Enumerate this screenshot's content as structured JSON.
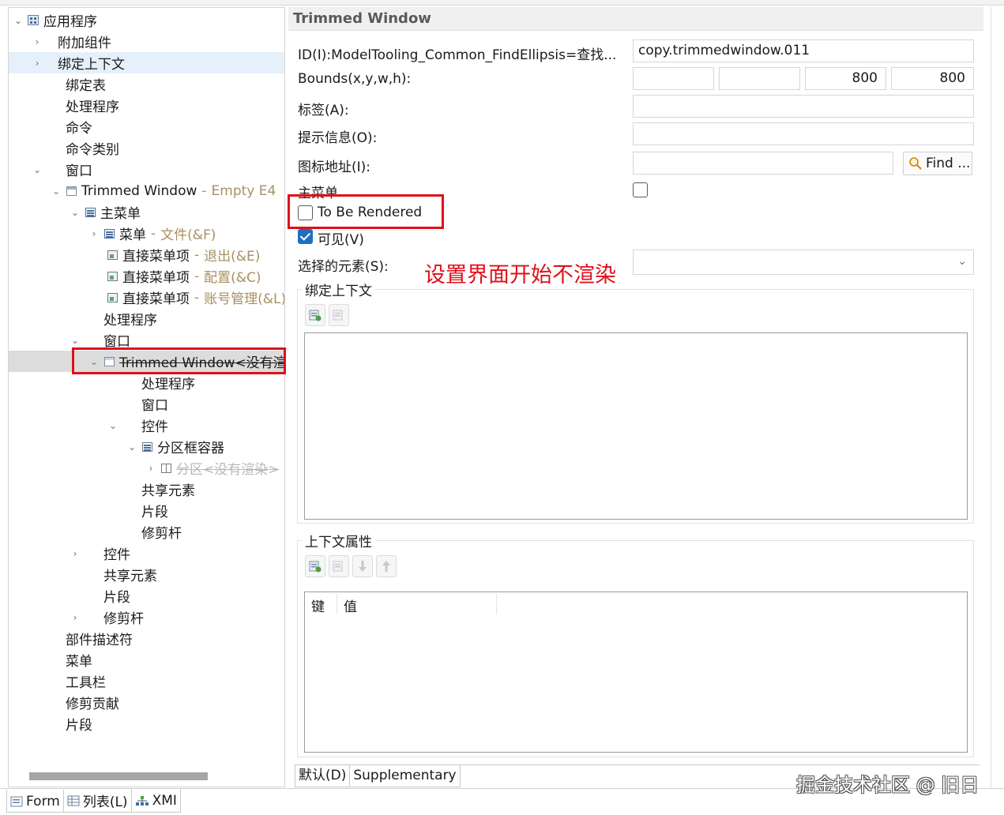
{
  "tree": {
    "rows": [
      {
        "label": "应用程序",
        "suffix": ""
      },
      {
        "label": "附加组件",
        "suffix": ""
      },
      {
        "label": "绑定上下文",
        "suffix": ""
      },
      {
        "label": "绑定表",
        "suffix": ""
      },
      {
        "label": "处理程序",
        "suffix": ""
      },
      {
        "label": "命令",
        "suffix": ""
      },
      {
        "label": "命令类别",
        "suffix": ""
      },
      {
        "label": "窗口",
        "suffix": ""
      },
      {
        "label": "Trimmed Window",
        "suffix": "Empty E4"
      },
      {
        "label": "主菜单",
        "suffix": ""
      },
      {
        "label": "菜单",
        "suffix": "文件(&F)"
      },
      {
        "label": "直接菜单项",
        "suffix": "退出(&E)"
      },
      {
        "label": "直接菜单项",
        "suffix": "配置(&C)"
      },
      {
        "label": "直接菜单项",
        "suffix": "账号管理(&L)"
      },
      {
        "label": "处理程序",
        "suffix": ""
      },
      {
        "label": "窗口",
        "suffix": ""
      },
      {
        "label": "Trimmed Window<没有渲染>",
        "suffix": ""
      },
      {
        "label": "处理程序",
        "suffix": ""
      },
      {
        "label": "窗口",
        "suffix": ""
      },
      {
        "label": "控件",
        "suffix": ""
      },
      {
        "label": "分区框容器",
        "suffix": ""
      },
      {
        "label": "分区<没有渲染>",
        "suffix": ""
      },
      {
        "label": "共享元素",
        "suffix": ""
      },
      {
        "label": "片段",
        "suffix": ""
      },
      {
        "label": "修剪杆",
        "suffix": ""
      },
      {
        "label": "控件",
        "suffix": ""
      },
      {
        "label": "共享元素",
        "suffix": ""
      },
      {
        "label": "片段",
        "suffix": ""
      },
      {
        "label": "修剪杆",
        "suffix": ""
      },
      {
        "label": "部件描述符",
        "suffix": ""
      },
      {
        "label": "菜单",
        "suffix": ""
      },
      {
        "label": "工具栏",
        "suffix": ""
      },
      {
        "label": "修剪贡献",
        "suffix": ""
      },
      {
        "label": "片段",
        "suffix": ""
      }
    ]
  },
  "props": {
    "title": "Trimmed Window",
    "id_label": "ID(I):ModelTooling_Common_FindEllipsis=查找...",
    "id_value": "copy.trimmedwindow.011",
    "bounds_label": "Bounds(x,y,w,h):",
    "bounds": [
      "",
      "",
      "800",
      "800"
    ],
    "tag_label": "标签(A):",
    "tag_value": "",
    "tooltip_label": "提示信息(O):",
    "tooltip_value": "",
    "icon_label": "图标地址(I):",
    "icon_value": "",
    "find_label": "Find ...",
    "main_menu_label": "主菜单",
    "main_menu_checked": false,
    "to_be_rendered_label": "To Be Rendered",
    "to_be_rendered_checked": false,
    "visible_label": "可见(V)",
    "visible_checked": true,
    "selected_elem_label": "选择的元素(S):",
    "selected_elem_value": "",
    "binding_group_title": "绑定上下文",
    "context_group_title": "上下文属性",
    "col_key": "键",
    "col_value": "值"
  },
  "annotation": "设置界面开始不渲染",
  "prop_tabs": [
    "默认(D)",
    "Supplementary"
  ],
  "editor_tabs": [
    {
      "label": "Form",
      "icon": "form-icon"
    },
    {
      "label": "列表(L)",
      "icon": "list-icon"
    },
    {
      "label": "XMI",
      "icon": "xmi-icon"
    }
  ],
  "watermark": "掘金技术社区 @ 旧日",
  "colors": {
    "accent": "#1e6fc2",
    "annotation_red": "#e0101a",
    "suffix": "#a89060"
  }
}
